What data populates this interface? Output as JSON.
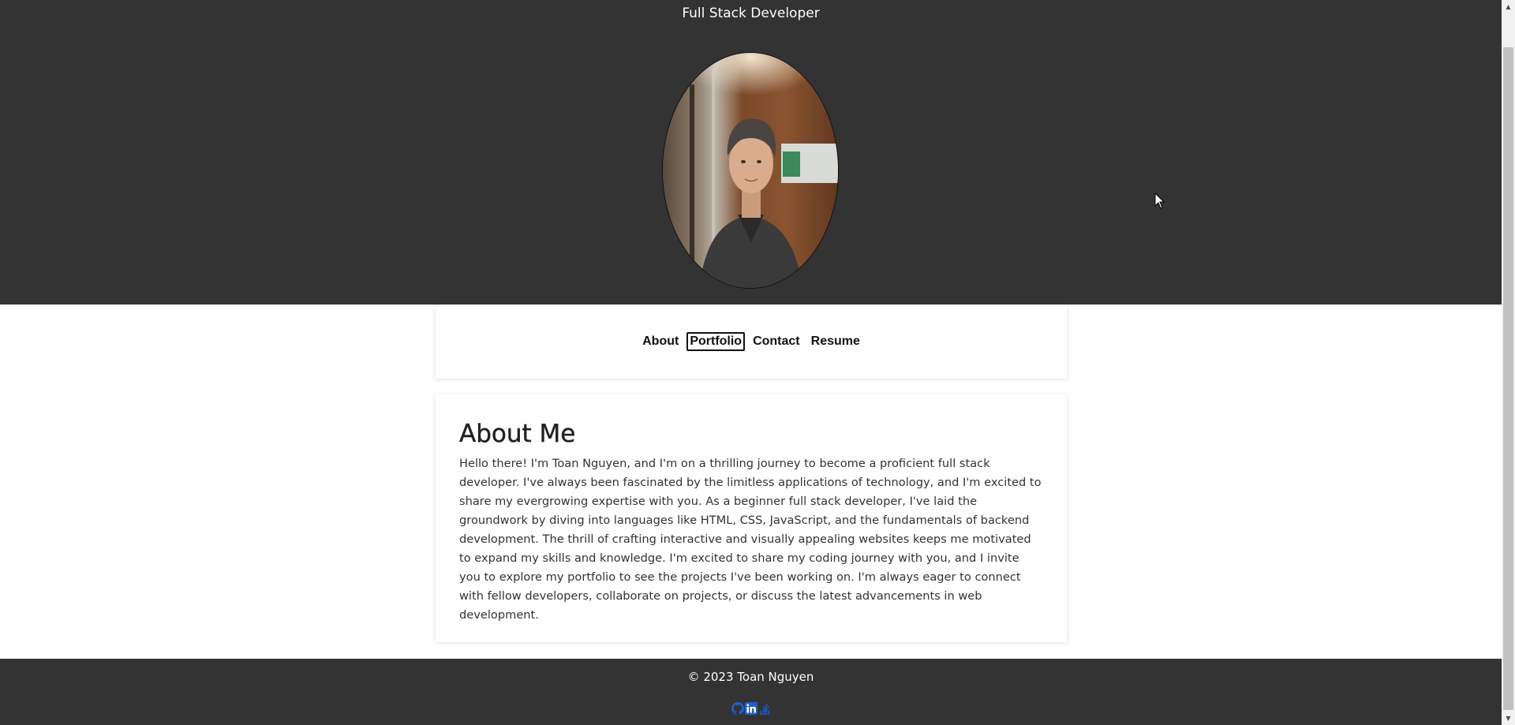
{
  "header": {
    "subtitle": "Full Stack Developer"
  },
  "nav": {
    "items": [
      {
        "label": "About",
        "focused": false
      },
      {
        "label": "Portfolio",
        "focused": true
      },
      {
        "label": "Contact",
        "focused": false
      },
      {
        "label": "Resume",
        "focused": false
      }
    ]
  },
  "about": {
    "title": "About Me",
    "body": "Hello there! I'm Toan Nguyen, and I'm on a thrilling journey to become a proficient full stack developer. I've always been fascinated by the limitless applications of technology, and I'm excited to share my evergrowing expertise with you. As a beginner full stack developer, I've laid the groundwork by diving into languages like HTML, CSS, JavaScript, and the fundamentals of backend development. The thrill of crafting interactive and visually appealing websites keeps me motivated to expand my skills and knowledge. I'm excited to share my coding journey with you, and I invite you to explore my portfolio to see the projects I've been working on. I'm always eager to connect with fellow developers, collaborate on projects, or discuss the latest advancements in web development."
  },
  "footer": {
    "copyright": "© 2023 Toan Nguyen",
    "social_icons": [
      "github-icon",
      "linkedin-icon",
      "stackoverflow-icon"
    ]
  },
  "colors": {
    "header_bg": "#333333",
    "footer_bg": "#333333",
    "social_icon": "#1a5fd6"
  }
}
